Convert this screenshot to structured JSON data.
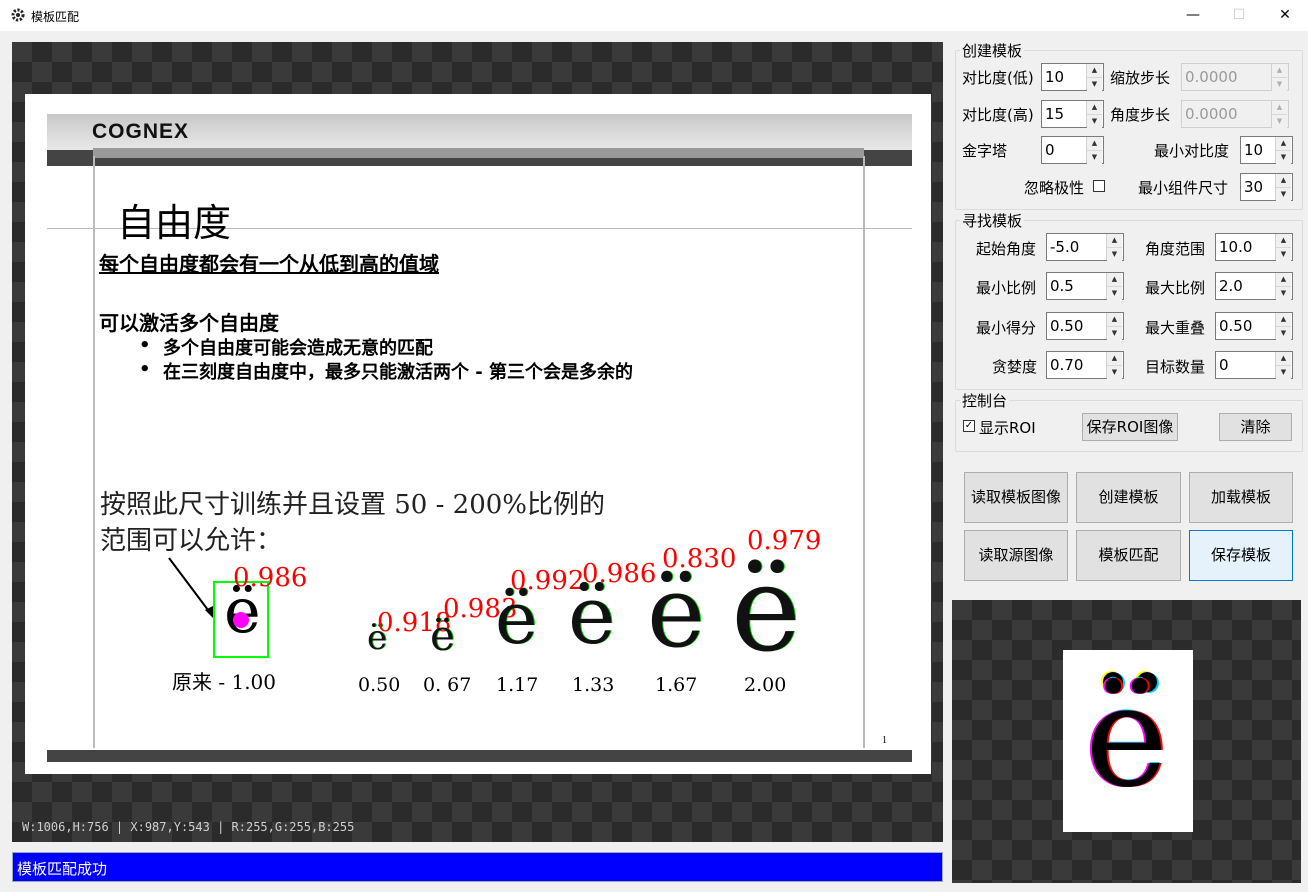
{
  "window": {
    "title": "模板匹配",
    "minimize": "—",
    "maximize": "☐",
    "close": "✕"
  },
  "slide": {
    "brand": "COGNEX",
    "heading": "自由度",
    "line1": "每个自由度都会有一个从低到高的值域",
    "line2": "可以激活多个自由度",
    "bullet1": "多个自由度可能会造成无意的匹配",
    "bullet2": "在三刻度自由度中，最多只能激活两个 -  第三个会是多余的",
    "train_text1": "按照此尺寸训练并且设置 50 - 200%比例的",
    "train_text2": "范围可以允许：",
    "original_label": "原来 - 1.00",
    "page_number": "1",
    "letters": [
      {
        "glyph": "ë",
        "scale_label": "0.50",
        "score": "0.918"
      },
      {
        "glyph": "ë",
        "scale_label": "0. 67",
        "score": "0.983"
      },
      {
        "glyph": "ë",
        "scale_label": "1.17",
        "score": "0.992"
      },
      {
        "glyph": "ë",
        "scale_label": "1.33",
        "score": "0.986"
      },
      {
        "glyph": "ë",
        "scale_label": "1.67",
        "score": "0.830"
      },
      {
        "glyph": "ë",
        "scale_label": "2.00",
        "score": "0.979"
      }
    ],
    "original_score": "0.986",
    "original_glyph": "ë"
  },
  "info_bar": "W:1006,H:756 | X:987,Y:543 | R:255,G:255,B:255",
  "status": "模板匹配成功",
  "create_template": {
    "legend": "创建模板",
    "contrast_low_label": "对比度(低)",
    "contrast_low": "10",
    "zoom_step_label": "缩放步长",
    "zoom_step": "0.0000",
    "contrast_high_label": "对比度(高)",
    "contrast_high": "15",
    "angle_step_label": "角度步长",
    "angle_step": "0.0000",
    "pyramid_label": "金字塔",
    "pyramid": "0",
    "min_contrast_label": "最小对比度",
    "min_contrast": "10",
    "ignore_polarity_label": "忽略极性",
    "min_component_label": "最小组件尺寸",
    "min_component": "30"
  },
  "find_template": {
    "legend": "寻找模板",
    "start_angle_label": "起始角度",
    "start_angle": "-5.0",
    "angle_range_label": "角度范围",
    "angle_range": "10.0",
    "min_scale_label": "最小比例",
    "min_scale": "0.5",
    "max_scale_label": "最大比例",
    "max_scale": "2.0",
    "min_score_label": "最小得分",
    "min_score": "0.50",
    "max_overlap_label": "最大重叠",
    "max_overlap": "0.50",
    "greediness_label": "贪婪度",
    "greediness": "0.70",
    "num_targets_label": "目标数量",
    "num_targets": "0"
  },
  "console": {
    "legend": "控制台",
    "show_roi_label": "显示ROI",
    "save_roi_button": "保存ROI图像",
    "clear_button": "清除"
  },
  "actions": {
    "read_template_image": "读取模板图像",
    "create_template": "创建模板",
    "load_template": "加载模板",
    "read_source_image": "读取源图像",
    "template_match": "模板匹配",
    "save_template": "保存模板"
  },
  "colors": {
    "status_bg": "#0000ff",
    "score_red": "#ff0000",
    "box_green": "#00ff00",
    "marker_magenta": "#ff00ff"
  }
}
